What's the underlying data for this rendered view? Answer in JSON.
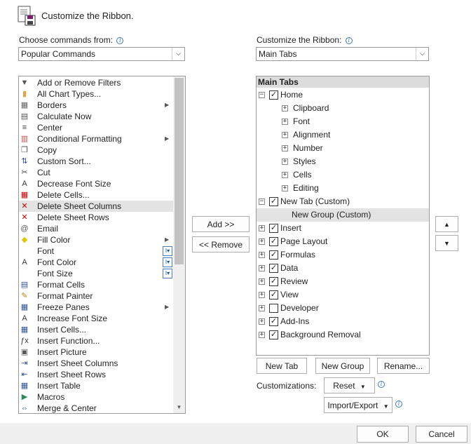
{
  "header": {
    "icon": "save-options-icon",
    "title": "Customize the Ribbon."
  },
  "left": {
    "label": "Choose commands from:",
    "combo_value": "Popular Commands",
    "commands": [
      {
        "label": "Add or Remove Filters",
        "icon": "filter-icon",
        "glyph": "▼",
        "color": "#555555"
      },
      {
        "label": "All Chart Types...",
        "icon": "chart-icon",
        "glyph": "▮",
        "color": "#e8a33c"
      },
      {
        "label": "Borders",
        "icon": "borders-icon",
        "glyph": "▦",
        "color": "#666666",
        "submenu": true
      },
      {
        "label": "Calculate Now",
        "icon": "calculator-icon",
        "glyph": "▤",
        "color": "#555555"
      },
      {
        "label": "Center",
        "icon": "center-align-icon",
        "glyph": "≡",
        "color": "#444444"
      },
      {
        "label": "Conditional Formatting",
        "icon": "conditional-formatting-icon",
        "glyph": "▥",
        "color": "#c0504d",
        "submenu": true
      },
      {
        "label": "Copy",
        "icon": "copy-icon",
        "glyph": "❐",
        "color": "#555555"
      },
      {
        "label": "Custom Sort...",
        "icon": "sort-icon",
        "glyph": "⇅",
        "color": "#2f5597"
      },
      {
        "label": "Cut",
        "icon": "scissors-icon",
        "glyph": "✂",
        "color": "#444444"
      },
      {
        "label": "Decrease Font Size",
        "icon": "decrease-font-icon",
        "glyph": "A",
        "color": "#333333"
      },
      {
        "label": "Delete Cells...",
        "icon": "delete-cells-icon",
        "glyph": "▦",
        "color": "#c00000"
      },
      {
        "label": "Delete Sheet Columns",
        "icon": "delete-columns-icon",
        "glyph": "✕",
        "color": "#c00000",
        "selected": true
      },
      {
        "label": "Delete Sheet Rows",
        "icon": "delete-rows-icon",
        "glyph": "✕",
        "color": "#c00000"
      },
      {
        "label": "Email",
        "icon": "email-icon",
        "glyph": "@",
        "color": "#555555"
      },
      {
        "label": "Fill Color",
        "icon": "fill-color-icon",
        "glyph": "◆",
        "color": "#e3c500",
        "submenu": true
      },
      {
        "label": "Font",
        "icon": "font-icon",
        "glyph": "",
        "color": "#333333",
        "dropdown": true
      },
      {
        "label": "Font Color",
        "icon": "font-color-icon",
        "glyph": "A",
        "color": "#333333",
        "dropdown": true
      },
      {
        "label": "Font Size",
        "icon": "font-size-icon",
        "glyph": "",
        "color": "#333333",
        "dropdown": true
      },
      {
        "label": "Format Cells",
        "icon": "format-cells-icon",
        "glyph": "▤",
        "color": "#2f5597"
      },
      {
        "label": "Format Painter",
        "icon": "format-painter-icon",
        "glyph": "✎",
        "color": "#b8860b"
      },
      {
        "label": "Freeze Panes",
        "icon": "freeze-panes-icon",
        "glyph": "▦",
        "color": "#2f5597",
        "submenu": true
      },
      {
        "label": "Increase Font Size",
        "icon": "increase-font-icon",
        "glyph": "A",
        "color": "#333333"
      },
      {
        "label": "Insert Cells...",
        "icon": "insert-cells-icon",
        "glyph": "▦",
        "color": "#2f5597"
      },
      {
        "label": "Insert Function...",
        "icon": "function-icon",
        "glyph": "ƒx",
        "color": "#333333"
      },
      {
        "label": "Insert Picture",
        "icon": "picture-icon",
        "glyph": "▣",
        "color": "#555555"
      },
      {
        "label": "Insert Sheet Columns",
        "icon": "insert-columns-icon",
        "glyph": "⇥",
        "color": "#2f5597"
      },
      {
        "label": "Insert Sheet Rows",
        "icon": "insert-rows-icon",
        "glyph": "⇤",
        "color": "#2f5597"
      },
      {
        "label": "Insert Table",
        "icon": "table-icon",
        "glyph": "▦",
        "color": "#2f5597"
      },
      {
        "label": "Macros",
        "icon": "macros-icon",
        "glyph": "▶",
        "color": "#2e8b57"
      },
      {
        "label": "Merge & Center",
        "icon": "merge-center-icon",
        "glyph": "⇔",
        "color": "#2f5597"
      }
    ]
  },
  "middle": {
    "add_label": "Add >>",
    "remove_label": "<< Remove"
  },
  "right": {
    "label": "Customize the Ribbon:",
    "combo_value": "Main Tabs",
    "tree_header": "Main Tabs",
    "tree": [
      {
        "label": "Home",
        "level": 0,
        "expander": "−",
        "checked": true
      },
      {
        "label": "Clipboard",
        "level": 1,
        "expander": "+"
      },
      {
        "label": "Font",
        "level": 1,
        "expander": "+"
      },
      {
        "label": "Alignment",
        "level": 1,
        "expander": "+"
      },
      {
        "label": "Number",
        "level": 1,
        "expander": "+"
      },
      {
        "label": "Styles",
        "level": 1,
        "expander": "+"
      },
      {
        "label": "Cells",
        "level": 1,
        "expander": "+"
      },
      {
        "label": "Editing",
        "level": 1,
        "expander": "+"
      },
      {
        "label": "New Tab (Custom)",
        "level": 0,
        "expander": "−",
        "checked": true
      },
      {
        "label": "New Group (Custom)",
        "level": 2,
        "selected": true
      },
      {
        "label": "Insert",
        "level": 0,
        "expander": "+",
        "checked": true
      },
      {
        "label": "Page Layout",
        "level": 0,
        "expander": "+",
        "checked": true
      },
      {
        "label": "Formulas",
        "level": 0,
        "expander": "+",
        "checked": true
      },
      {
        "label": "Data",
        "level": 0,
        "expander": "+",
        "checked": true
      },
      {
        "label": "Review",
        "level": 0,
        "expander": "+",
        "checked": true
      },
      {
        "label": "View",
        "level": 0,
        "expander": "+",
        "checked": true
      },
      {
        "label": "Developer",
        "level": 0,
        "expander": "+",
        "checked": false
      },
      {
        "label": "Add-Ins",
        "level": 0,
        "expander": "+",
        "checked": true
      },
      {
        "label": "Background Removal",
        "level": 0,
        "expander": "+",
        "checked": true
      }
    ],
    "new_tab_label": "New Tab",
    "new_group_label": "New Group",
    "rename_label": "Rename...",
    "customizations_label": "Customizations:",
    "reset_label": "Reset",
    "import_export_label": "Import/Export"
  },
  "footer": {
    "ok_label": "OK",
    "cancel_label": "Cancel"
  },
  "colors": {
    "selected_bg": "#e3e3e3",
    "accent": "#3a79c4"
  }
}
